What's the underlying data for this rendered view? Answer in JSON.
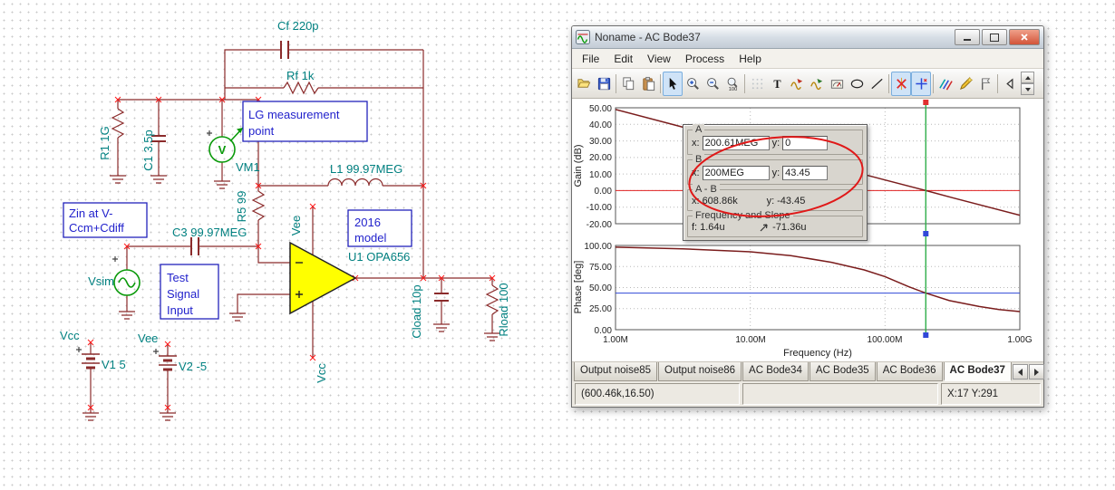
{
  "schematic": {
    "labels": {
      "cf": "Cf 220p",
      "rf": "Rf 1k",
      "lg1": "LG measurement",
      "lg2": "point",
      "r1": "R1 1G",
      "c1": "C1 3.5p",
      "vm1": "VM1",
      "vm1_symbol": "V",
      "l1": "L1 99.97MEG",
      "r5": "R5 99",
      "vee_opamp": "Vee",
      "zin1": "Zin at V-",
      "zin2": "Ccm+Cdiff",
      "c3": "C3 99.97MEG",
      "vsim": "Vsim",
      "test1": "Test",
      "test2": "Signal",
      "test3": "Input",
      "model1": "2016",
      "model2": "model",
      "u1": "U1 OPA656",
      "cload": "Cload 10p",
      "rload": "Rload 100",
      "vcc_v1": "Vcc",
      "vee_v2": "Vee",
      "v1": "V1 5",
      "v2": "V2 -5",
      "vcc_opamp": "Vcc"
    },
    "colors": {
      "wire": "#8b2b2b",
      "label": "#008080",
      "annotation_box": "#2222bb",
      "opamp_fill": "#ffff00",
      "source_green": "#0a9a0a",
      "terminal_mark": "#ff1a1a"
    }
  },
  "window": {
    "title": "Noname - AC Bode37",
    "menu": [
      "File",
      "Edit",
      "View",
      "Process",
      "Help"
    ],
    "toolbar": {
      "text_tool_label": "T",
      "zoom_100_label": "100",
      "icons": [
        "open-icon",
        "save-icon",
        "copy-icon",
        "paste-icon",
        "pointer-icon",
        "zoom-in-icon",
        "zoom-out-icon",
        "zoom-100-icon",
        "grid-icon",
        "text-tool-icon",
        "probe-a-icon",
        "probe-b-icon",
        "frequency-meter-icon",
        "ellipse-tool-icon",
        "line-tool-icon",
        "cursor-a-icon",
        "cursor-b-icon",
        "slope-lines-icon",
        "pen-icon",
        "flag-icon",
        "scroll-left-icon",
        "spin-up-icon",
        "spin-down-icon"
      ]
    },
    "chart_data": {
      "type": "line",
      "xlabel": "Frequency (Hz)",
      "x_log": true,
      "x_range_hz": [
        1000000,
        1000000000
      ],
      "x_tick_labels": [
        "1.00M",
        "10.00M",
        "100.00M",
        "1.00G"
      ],
      "panels": [
        {
          "ylabel": "Gain (dB)",
          "ylim": [
            -20,
            50
          ],
          "y_ticks": [
            "50.00",
            "40.00",
            "30.00",
            "20.00",
            "10.00",
            "0.00",
            "-10.00",
            "-20.00"
          ],
          "ref_line_value": 0,
          "ref_line_color": "#e02020",
          "series": [
            {
              "name": "Gain",
              "color": "#7a1c1c",
              "points": [
                [
                  1000000,
                  49
                ],
                [
                  3162000,
                  38.3
                ],
                [
                  10000000,
                  27.7
                ],
                [
                  31620000,
                  17.1
                ],
                [
                  100000000,
                  6.4
                ],
                [
                  200610000,
                  0
                ],
                [
                  316200000,
                  -4.3
                ],
                [
                  1000000000,
                  -14.9
                ]
              ]
            }
          ]
        },
        {
          "ylabel": "Phase [deg]",
          "ylim": [
            0,
            100
          ],
          "y_ticks": [
            "100.00",
            "75.00",
            "50.00",
            "25.00",
            "0.00"
          ],
          "ref_line_value": 43.45,
          "ref_line_color": "#3048d8",
          "series": [
            {
              "name": "Phase",
              "color": "#7a1c1c",
              "points": [
                [
                  1000000,
                  98
                ],
                [
                  3162000,
                  96
                ],
                [
                  10000000,
                  92.5
                ],
                [
                  20000000,
                  88
                ],
                [
                  40000000,
                  80
                ],
                [
                  70000000,
                  71
                ],
                [
                  100000000,
                  63
                ],
                [
                  150000000,
                  51
                ],
                [
                  200610000,
                  43.45
                ],
                [
                  300000000,
                  34.5
                ],
                [
                  500000000,
                  27.5
                ],
                [
                  700000000,
                  24
                ],
                [
                  1000000000,
                  21.5
                ]
              ]
            }
          ]
        }
      ],
      "cursor": {
        "frequency_hz": 200610000,
        "color": "#2fae4a"
      }
    },
    "cursor_panel": {
      "a_label": "A",
      "b_label": "B",
      "ab_label": "A - B",
      "fs_label": "Frequency and Slope",
      "x_label": "x:",
      "y_label": "y:",
      "f_label": "f:",
      "a_x": "200.61MEG",
      "a_y": "0",
      "b_x": "200MEG",
      "b_y": "43.45",
      "ab_x": "608.86k",
      "ab_y": "-43.45",
      "f_value": "1.64u",
      "slope_value": "-71.36u"
    },
    "tabs": [
      "Output noise85",
      "Output noise86",
      "AC Bode34",
      "AC Bode35",
      "AC Bode36",
      "AC Bode37"
    ],
    "active_tab": "AC Bode37",
    "status_left": "(600.46k,16.50)",
    "status_right": "X:17 Y:291"
  }
}
